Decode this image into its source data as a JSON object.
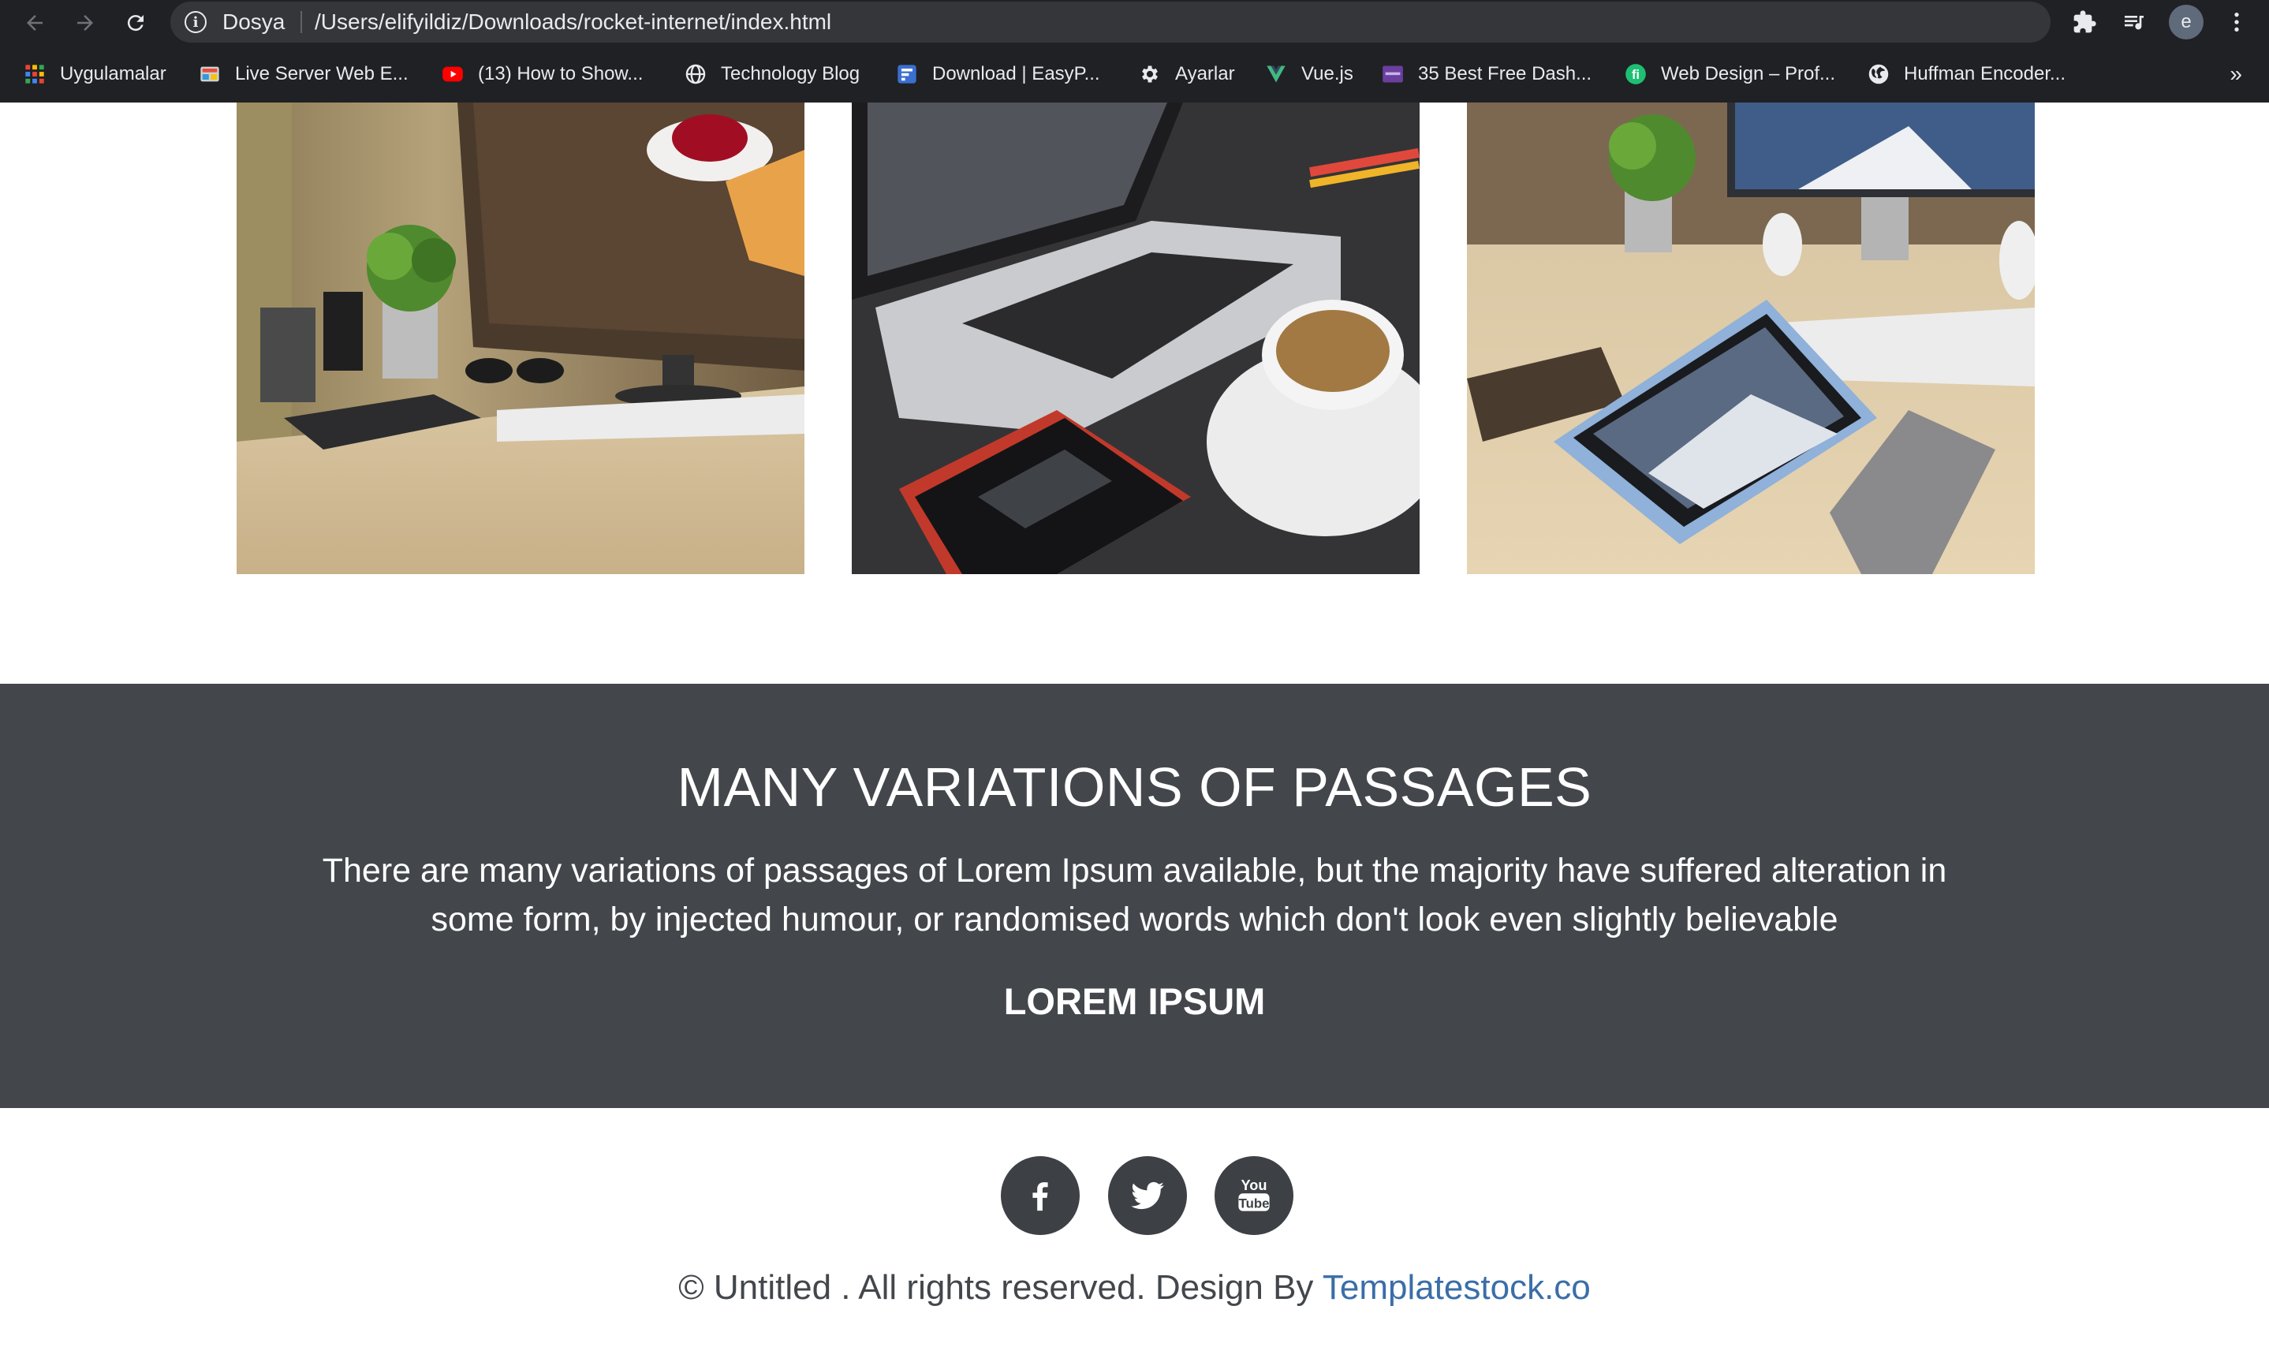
{
  "browser": {
    "scheme_label": "Dosya",
    "url": "/Users/elifyildiz/Downloads/rocket-internet/index.html",
    "profile_initial": "e",
    "bookmarks": [
      {
        "label": "Uygulamalar",
        "icon": "apps-grid-icon"
      },
      {
        "label": "Live Server Web E...",
        "icon": "live-server-icon"
      },
      {
        "label": "(13) How to Show...",
        "icon": "youtube-icon"
      },
      {
        "label": "Technology Blog",
        "icon": "globe-icon"
      },
      {
        "label": "Download | EasyP...",
        "icon": "easyp-icon"
      },
      {
        "label": "Ayarlar",
        "icon": "gear-icon"
      },
      {
        "label": "Vue.js",
        "icon": "vue-icon"
      },
      {
        "label": "35 Best Free Dash...",
        "icon": "colorlib-icon"
      },
      {
        "label": "Web Design – Prof...",
        "icon": "fiverr-icon"
      },
      {
        "label": "Huffman Encoder...",
        "icon": "world-icon"
      }
    ],
    "more_label": "»"
  },
  "gallery": {
    "images": [
      "desk-monitor-plant",
      "laptop-coffee-phone",
      "tablet-keyboard-desk"
    ]
  },
  "banner": {
    "title": "MANY VARIATIONS OF PASSAGES",
    "text": "There are many variations of passages of Lorem Ipsum available, but the majority have suffered alteration in some form, by injected humour, or randomised words which don't look even slightly believable",
    "subtitle": "LOREM IPSUM",
    "background": "#43474c"
  },
  "footer": {
    "social": [
      "facebook-icon",
      "twitter-icon",
      "youtube-icon"
    ],
    "copyright": "© Untitled . All rights reserved. Design By ",
    "link_label": "Templatestock.co",
    "link_color": "#3a6ea8"
  }
}
